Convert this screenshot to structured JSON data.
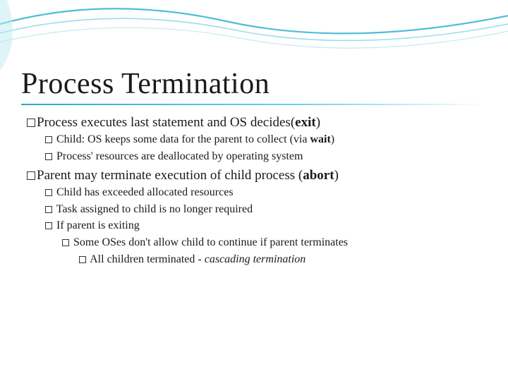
{
  "slide": {
    "title": "Process Termination",
    "items": [
      {
        "text_pre": "Process executes last statement and OS decides(",
        "bold": "exit",
        "text_post": ")",
        "sub": [
          {
            "text_pre": "Child: OS keeps some data for the parent to collect (via ",
            "bold": "wait",
            "text_post": ")"
          },
          {
            "text_pre": "Process' resources are deallocated by operating system"
          }
        ]
      },
      {
        "text_pre": "Parent may terminate execution of child process (",
        "bold": "abort",
        "text_post": ")",
        "sub": [
          {
            "text_pre": "Child has exceeded allocated resources"
          },
          {
            "text_pre": "Task assigned to child is no longer required"
          },
          {
            "text_pre": "If parent is exiting",
            "sub": [
              {
                "text_pre": "Some OSes don't allow child to continue if parent terminates",
                "sub": [
                  {
                    "text_pre": "All children terminated - ",
                    "em": "cascading termination"
                  }
                ]
              }
            ]
          }
        ]
      }
    ]
  }
}
